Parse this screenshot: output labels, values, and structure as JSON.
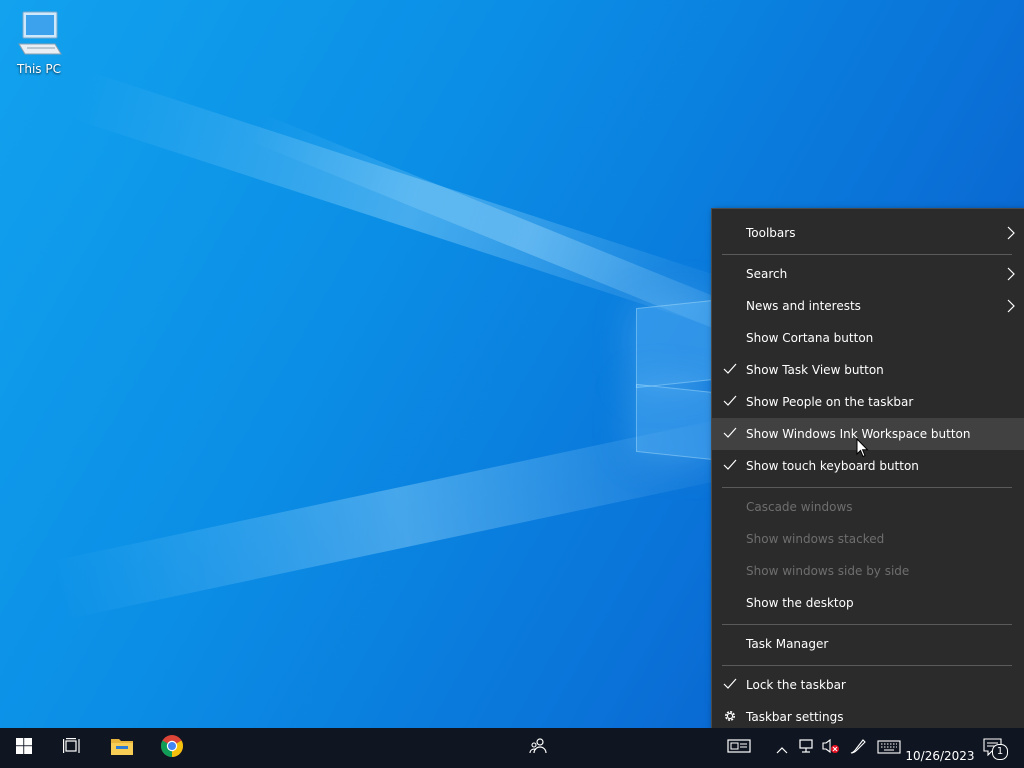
{
  "desktop": {
    "icons": [
      {
        "label": "This PC",
        "icon": "computer-icon"
      }
    ]
  },
  "context_menu": {
    "items": [
      {
        "label": "Toolbars",
        "checked": false,
        "submenu": true,
        "enabled": true
      },
      {
        "label": "Search",
        "checked": false,
        "submenu": true,
        "enabled": true
      },
      {
        "label": "News and interests",
        "checked": false,
        "submenu": true,
        "enabled": true
      },
      {
        "label": "Show Cortana button",
        "checked": false,
        "submenu": false,
        "enabled": true
      },
      {
        "label": "Show Task View button",
        "checked": true,
        "submenu": false,
        "enabled": true
      },
      {
        "label": "Show People on the taskbar",
        "checked": true,
        "submenu": false,
        "enabled": true
      },
      {
        "label": "Show Windows Ink Workspace button",
        "checked": true,
        "submenu": false,
        "enabled": true,
        "hovered": true
      },
      {
        "label": "Show touch keyboard button",
        "checked": true,
        "submenu": false,
        "enabled": true
      },
      {
        "label": "Cascade windows",
        "checked": false,
        "submenu": false,
        "enabled": false
      },
      {
        "label": "Show windows stacked",
        "checked": false,
        "submenu": false,
        "enabled": false
      },
      {
        "label": "Show windows side by side",
        "checked": false,
        "submenu": false,
        "enabled": false
      },
      {
        "label": "Show the desktop",
        "checked": false,
        "submenu": false,
        "enabled": true
      },
      {
        "label": "Task Manager",
        "checked": false,
        "submenu": false,
        "enabled": true
      },
      {
        "label": "Lock the taskbar",
        "checked": true,
        "submenu": false,
        "enabled": true
      },
      {
        "label": "Taskbar settings",
        "checked": false,
        "submenu": false,
        "enabled": true,
        "icon": "gear-icon"
      }
    ]
  },
  "taskbar": {
    "buttons": [
      "start-icon",
      "task-view-icon",
      "file-explorer-icon",
      "chrome-icon",
      "people-icon"
    ],
    "tray": [
      "news-icon",
      "chevron-up-icon",
      "network-icon",
      "volume-muted-icon",
      "ink-workspace-icon",
      "touch-keyboard-icon"
    ],
    "clock": {
      "date": "10/26/2023"
    },
    "notifications": {
      "count": "1"
    }
  },
  "colors": {
    "menu_bg": "#2b2b2b",
    "menu_hover": "#414141",
    "taskbar_bg": "#101621",
    "desktop_blue": "#0b8fe6"
  }
}
